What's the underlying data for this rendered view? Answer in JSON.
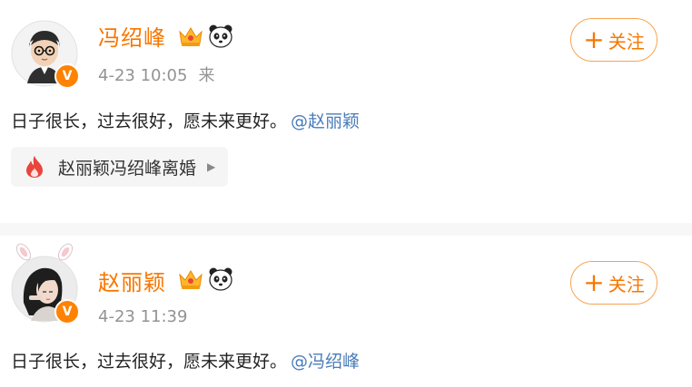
{
  "posts": [
    {
      "username": "冯绍峰",
      "time": "4-23 10:05",
      "source": "来",
      "content": "日子很长，过去很好，愿未来更好。",
      "mention": "@赵丽颖",
      "follow_label": "关注",
      "follow_plus": "+",
      "topic": "赵丽颖冯绍峰离婚",
      "verified_badge": "V"
    },
    {
      "username": "赵丽颖",
      "time": "4-23 11:39",
      "source": "",
      "content": "日子很长，过去很好，愿未来更好。",
      "mention": "@冯绍峰",
      "follow_label": "关注",
      "follow_plus": "+",
      "verified_badge": "V"
    }
  ],
  "icons": {
    "crown": "crown-icon",
    "panda": "panda-icon",
    "fire": "fire-icon",
    "arrow": "chevron-right-icon"
  },
  "colors": {
    "username": "#f77700",
    "follow_border": "#f7a350",
    "mention": "#4a7cb8",
    "verified": "#ff8200",
    "fire": "#e8453c",
    "meta": "#939393"
  }
}
